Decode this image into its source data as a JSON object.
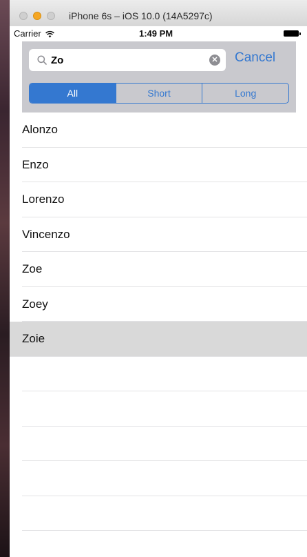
{
  "window": {
    "title": "iPhone 6s – iOS 10.0 (14A5297c)"
  },
  "status_bar": {
    "carrier": "Carrier",
    "time": "1:49 PM"
  },
  "search": {
    "value": "Zo",
    "cancel_label": "Cancel"
  },
  "scope": {
    "segments": [
      {
        "label": "All",
        "selected": true
      },
      {
        "label": "Short",
        "selected": false
      },
      {
        "label": "Long",
        "selected": false
      }
    ]
  },
  "results": {
    "items": [
      {
        "label": "Alonzo"
      },
      {
        "label": "Enzo"
      },
      {
        "label": "Lorenzo"
      },
      {
        "label": "Vincenzo"
      },
      {
        "label": "Zoe"
      },
      {
        "label": "Zoey"
      },
      {
        "label": "Zoie",
        "highlighted": true
      }
    ],
    "empty_rows": 5
  },
  "colors": {
    "accent": "#3478d0",
    "search_bar_background": "#c9c9ce",
    "highlight": "#d9d9d9"
  },
  "icons": {
    "search": "search-icon",
    "clear": "clear-text-icon",
    "wifi": "wifi-icon",
    "battery": "battery-icon"
  }
}
